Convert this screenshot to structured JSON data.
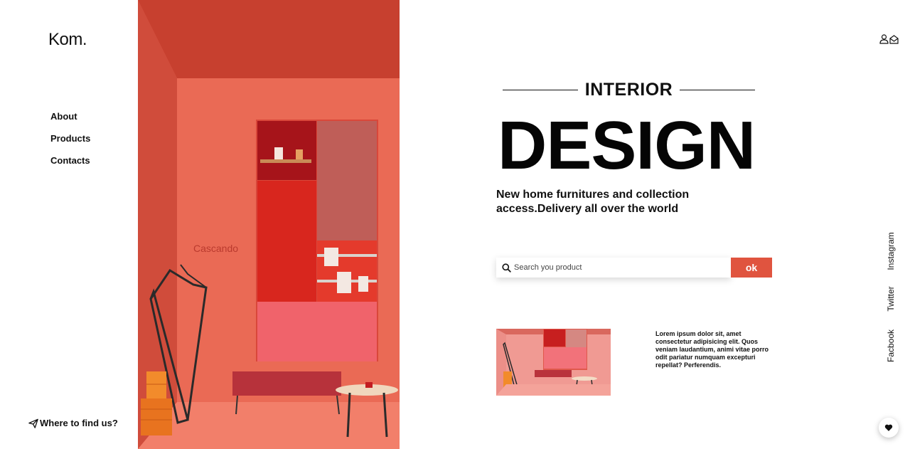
{
  "brand": {
    "logo": "Kom."
  },
  "nav": {
    "items": [
      "About",
      "Products",
      "Contacts"
    ]
  },
  "footer_link": {
    "label": "Where to find us?"
  },
  "hero": {
    "brand_text": "Cascando"
  },
  "main": {
    "kicker": "INTERIOR",
    "headline": "DESIGN",
    "subline": "New home furnitures and collection access.Delivery all over the world"
  },
  "search": {
    "placeholder": "Search you product",
    "button": "ok"
  },
  "blurb": {
    "text": "Lorem ipsum dolor sit, amet consectetur adipisicing elit. Quos veniam laudantium, animi vitae porro odit pariatur numquam excepturi repellat? Perferendis."
  },
  "social": {
    "instagram": "Instagram",
    "twitter": "Twitter",
    "facebook": "Facbook"
  },
  "icons": {
    "user": "user-icon",
    "mail": "mail-icon",
    "send": "paper-plane-icon",
    "search": "search-icon",
    "favorite": "heart-icon"
  },
  "colors": {
    "accent": "#e0543f",
    "text": "#111111",
    "background": "#ffffff"
  }
}
